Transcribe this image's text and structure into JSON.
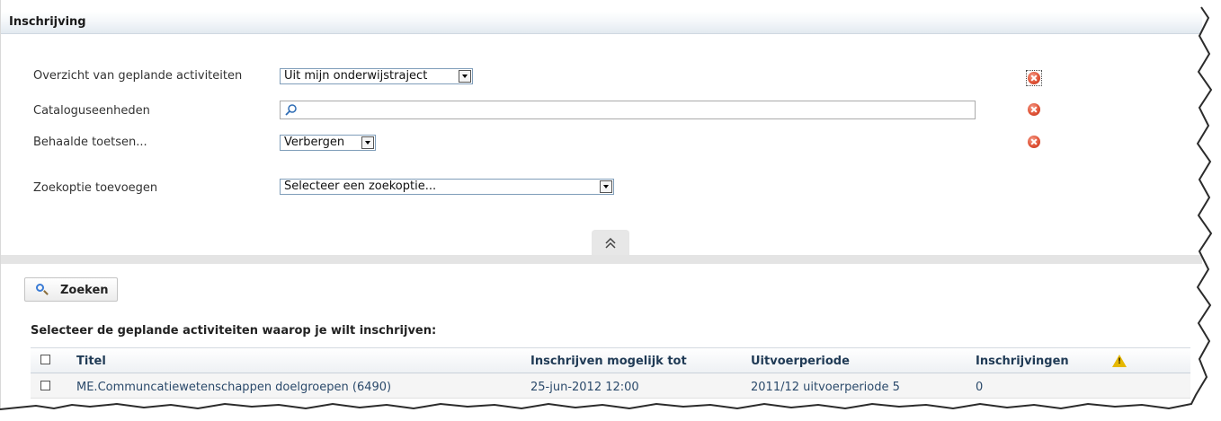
{
  "panel": {
    "title": "Inschrijving"
  },
  "filters": {
    "activities": {
      "label": "Overzicht van geplande activiteiten",
      "value": "Uit mijn onderwijstraject"
    },
    "catalog": {
      "label": "Cataloguseenheden",
      "value": ""
    },
    "tests": {
      "label": "Behaalde toetsen...",
      "value": "Verbergen"
    },
    "add": {
      "label": "Zoekoptie toevoegen",
      "value": "Selecteer een zoekoptie..."
    }
  },
  "search_button": {
    "label": "Zoeken"
  },
  "instruction": "Selecteer de geplande activiteiten waarop je wilt inschrijven:",
  "table": {
    "headers": {
      "title": "Titel",
      "deadline": "Inschrijven mogelijk tot",
      "period": "Uitvoerperiode",
      "enrollments": "Inschrijvingen"
    },
    "rows": [
      {
        "title": "ME.Communcatiewetenschappen doelgroepen (6490)",
        "deadline": "25-jun-2012 12:00",
        "period": "2011/12 uitvoerperiode 5",
        "enrollments": "0"
      }
    ]
  },
  "icons": {
    "remove": "remove-filter-icon",
    "search": "magnifier-icon",
    "collapse": "double-chevron-up-icon",
    "warning": "warning-triangle-icon"
  },
  "colors": {
    "remove_icon": "#e05437",
    "warning_icon": "#e6b800",
    "header_text": "#1f3a55",
    "row_text": "#2b4a6b"
  }
}
